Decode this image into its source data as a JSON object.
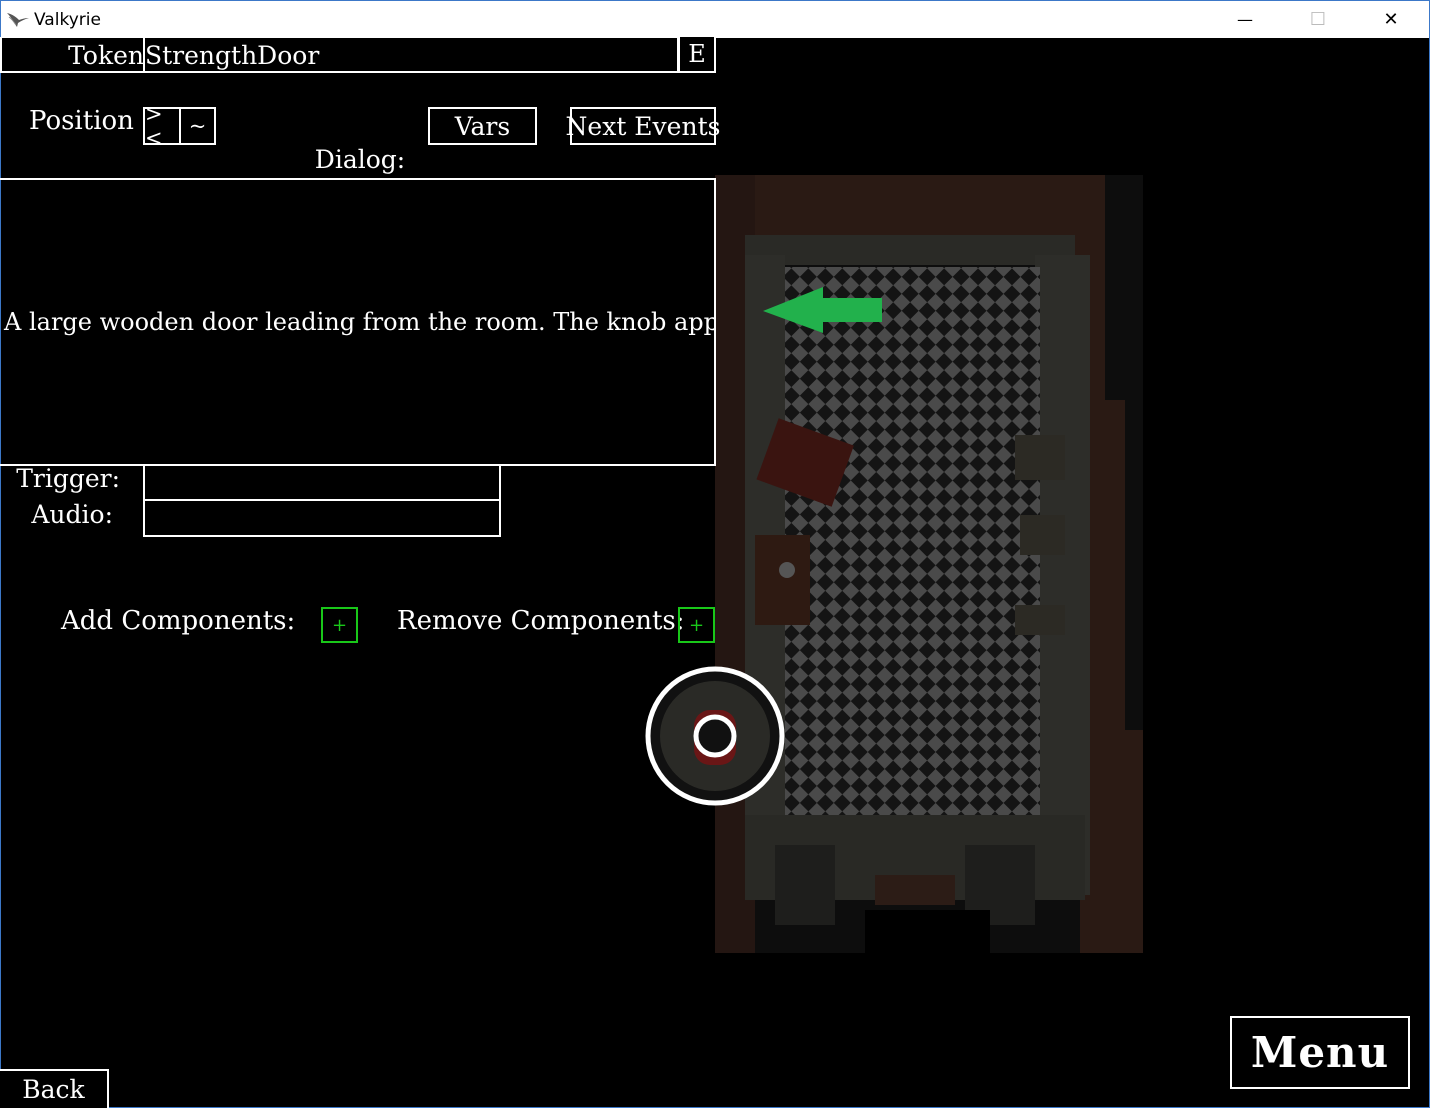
{
  "window": {
    "title": "Valkyrie",
    "minimize_glyph": "—",
    "maximize_glyph": "☐",
    "close_glyph": "✕"
  },
  "editor": {
    "type_label": "Token",
    "name_value": "StrengthDoor",
    "edit_button": "E",
    "position_label": "Position",
    "position_center_button": "><",
    "position_fine_button": "~",
    "vars_button": "Vars",
    "next_events_button": "Next Events",
    "dialog_label": "Dialog:",
    "dialog_text": "A large wooden door leading from the room. The knob appears",
    "trigger_label": "Trigger:",
    "trigger_value": "",
    "audio_label": "Audio:",
    "audio_value": "",
    "add_components_label": "Add Components:",
    "add_components_button": "+",
    "remove_components_label": "Remove Components:",
    "remove_components_button": "+",
    "back_button": "Back"
  },
  "menu_button": "Menu",
  "icons": {
    "app": "valkyrie-wing-icon",
    "arrow": "green-arrow-icon",
    "token": "door-token-icon"
  },
  "colors": {
    "accent_green": "#19c819",
    "arrow_green": "#22b14c",
    "titlebar_border": "#3c78c8"
  }
}
